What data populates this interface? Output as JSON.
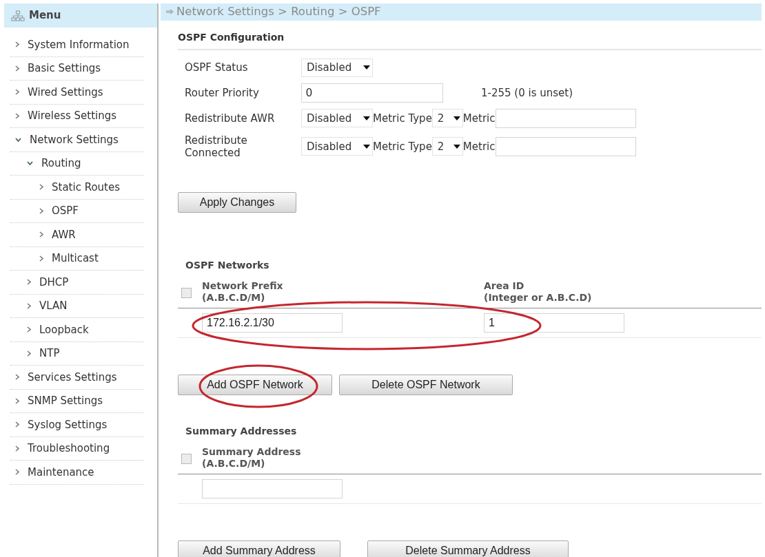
{
  "sidebar": {
    "title": "Menu",
    "items": [
      {
        "label": "System Information",
        "expanded": false
      },
      {
        "label": "Basic Settings",
        "expanded": false
      },
      {
        "label": "Wired Settings",
        "expanded": false
      },
      {
        "label": "Wireless Settings",
        "expanded": false
      },
      {
        "label": "Network Settings",
        "expanded": true,
        "children": [
          {
            "label": "Routing",
            "expanded": true,
            "children": [
              {
                "label": "Static Routes",
                "expanded": false
              },
              {
                "label": "OSPF",
                "expanded": false
              },
              {
                "label": "AWR",
                "expanded": false
              },
              {
                "label": "Multicast",
                "expanded": false
              }
            ]
          },
          {
            "label": "DHCP",
            "expanded": false
          },
          {
            "label": "VLAN",
            "expanded": false
          },
          {
            "label": "Loopback",
            "expanded": false
          },
          {
            "label": "NTP",
            "expanded": false
          }
        ]
      },
      {
        "label": "Services Settings",
        "expanded": false
      },
      {
        "label": "SNMP Settings",
        "expanded": false
      },
      {
        "label": "Syslog Settings",
        "expanded": false
      },
      {
        "label": "Troubleshooting",
        "expanded": false
      },
      {
        "label": "Maintenance",
        "expanded": false
      }
    ]
  },
  "breadcrumb": "Network Settings > Routing > OSPF",
  "ospf_configuration": {
    "title": "OSPF Configuration",
    "rows": [
      {
        "kind": "select",
        "label": "OSPF Status",
        "value": "Disabled"
      },
      {
        "kind": "input",
        "label": "Router Priority",
        "value": "0",
        "hint": "1-255 (0 is unset)"
      },
      {
        "kind": "redistribute",
        "label": "Redistribute AWR",
        "value": "Disabled",
        "metric_type_label": "Metric Type",
        "metric_type": "2",
        "metric_label": "Metric"
      },
      {
        "kind": "redistribute",
        "label": "Redistribute Connected",
        "value": "Disabled",
        "metric_type_label": "Metric Type",
        "metric_type": "2",
        "metric_label": "Metric"
      }
    ],
    "buttons": [
      {
        "label": "Apply Changes",
        "circled": false
      }
    ]
  },
  "ospf_networks": {
    "title": "OSPF Networks",
    "select_all": {
      "checked": false
    },
    "columns": [
      {
        "title": "Network Prefix",
        "subtitle": "(A.B.C.D/M)"
      },
      {
        "title": "Area ID",
        "subtitle": "(Integer or A.B.C.D)"
      }
    ],
    "rows": [
      {
        "cells": [
          "172.16.2.1/30",
          "1"
        ],
        "circled": true
      }
    ],
    "buttons": [
      {
        "label": "Add OSPF Network",
        "circled": true
      },
      {
        "label": "Delete OSPF Network",
        "circled": false
      }
    ]
  },
  "summary_addresses": {
    "title": "Summary Addresses",
    "select_all": {
      "checked": false
    },
    "columns": [
      {
        "title": "Summary Address",
        "subtitle": "(A.B.C.D/M)"
      }
    ],
    "rows": [
      {
        "circled": false
      }
    ],
    "buttons": [
      {
        "label": "Add Summary Address",
        "circled": false
      },
      {
        "label": "Delete Summary Address",
        "circled": false
      }
    ]
  }
}
